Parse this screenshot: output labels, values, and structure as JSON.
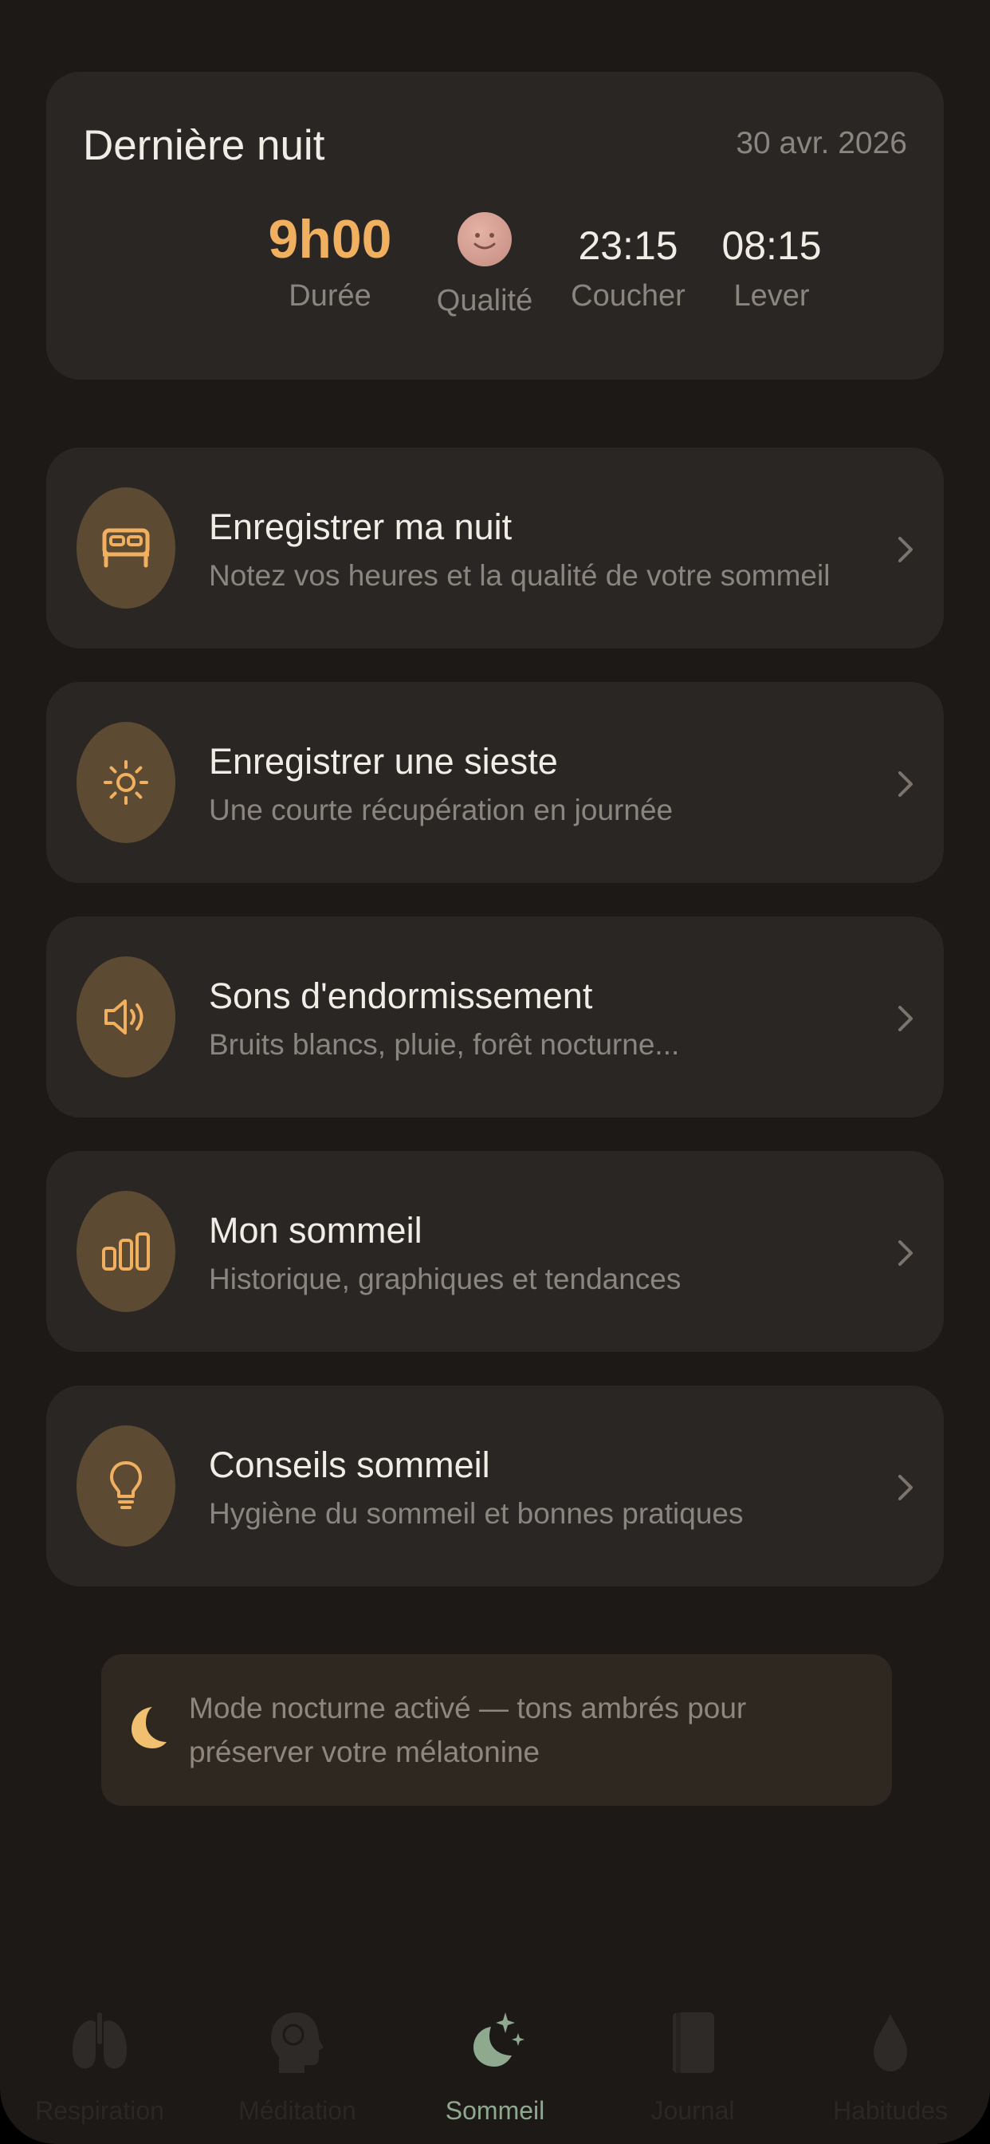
{
  "summary": {
    "title": "Dernière nuit",
    "date": "30 avr. 2026",
    "duration_value": "9h00",
    "duration_label": "Durée",
    "quality_label": "Qualité",
    "quality_icon": "smiley-face-icon",
    "bedtime_value": "23:15",
    "bedtime_label": "Coucher",
    "wake_value": "08:15",
    "wake_label": "Lever"
  },
  "menu": [
    {
      "title": "Enregistrer ma nuit",
      "subtitle": "Notez vos heures et la qualité de votre sommeil",
      "icon": "bed-icon"
    },
    {
      "title": "Enregistrer une sieste",
      "subtitle": "Une courte récupération en journée",
      "icon": "sun-icon"
    },
    {
      "title": "Sons d'endormissement",
      "subtitle": "Bruits blancs, pluie, forêt nocturne...",
      "icon": "speaker-icon"
    },
    {
      "title": "Mon sommeil",
      "subtitle": "Historique, graphiques et tendances",
      "icon": "bar-chart-icon"
    },
    {
      "title": "Conseils sommeil",
      "subtitle": "Hygiène du sommeil et bonnes pratiques",
      "icon": "lightbulb-icon"
    }
  ],
  "night_mode": {
    "text": "Mode nocturne activé — tons ambrés pour préserver votre mélatonine",
    "icon": "moon-icon"
  },
  "tabs": [
    {
      "label": "Respiration",
      "icon": "lungs-icon",
      "active": false
    },
    {
      "label": "Méditation",
      "icon": "brain-head-icon",
      "active": false
    },
    {
      "label": "Sommeil",
      "icon": "moon-stars-icon",
      "active": true
    },
    {
      "label": "Journal",
      "icon": "book-icon",
      "active": false
    },
    {
      "label": "Habitudes",
      "icon": "drop-icon",
      "active": false
    }
  ],
  "colors": {
    "background": "#1c1917",
    "card": "#2a2623",
    "accent": "#f0b060",
    "icon_circle": "#5d4a33",
    "active_tab": "#8fa98f"
  }
}
